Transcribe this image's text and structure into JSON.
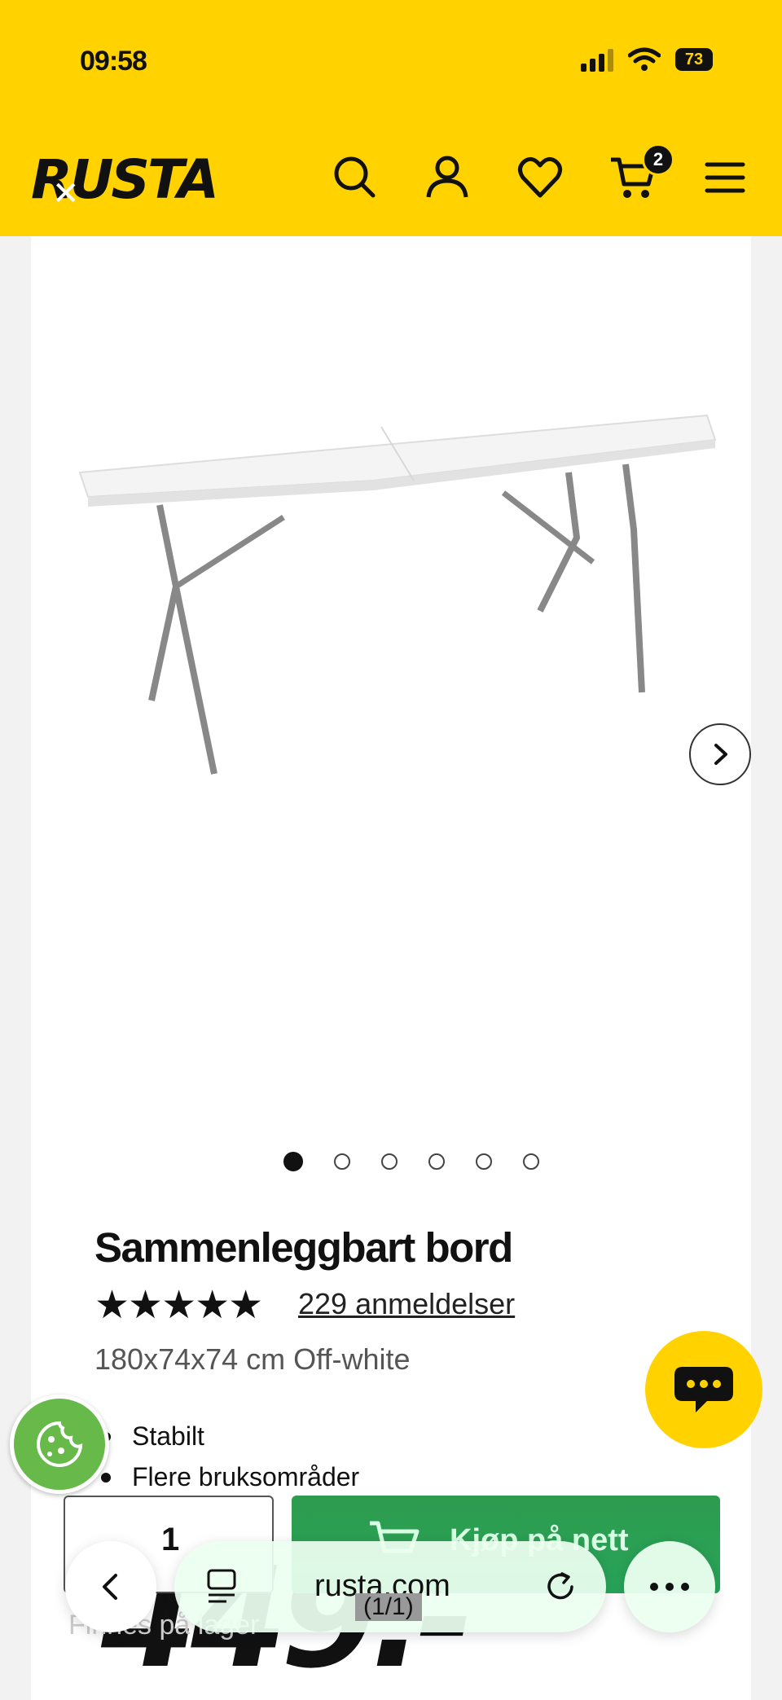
{
  "status_bar": {
    "time": "09:58",
    "battery": "73"
  },
  "header": {
    "logo": "RUSTA",
    "cart_count": "2"
  },
  "product": {
    "title": "Sammenleggbart bord",
    "rating_stars": "★★★★★",
    "reviews": "229 anmeldelser",
    "variant": "180x74x74 cm Off-white",
    "bullets": [
      "Stabilt",
      "Flere bruksområder"
    ],
    "price": "449.-",
    "image_count": 6,
    "active_image": 1
  },
  "purchase": {
    "quantity": "1",
    "buy_label": "Kjøp på nett"
  },
  "footer_hint": "Finnes på lager",
  "browser": {
    "url": "rusta.com",
    "page_count": "(1/1)"
  },
  "colors": {
    "brand_yellow": "#FFD200",
    "buy_green": "#2E9B4E",
    "cookie_green": "#67B94A"
  }
}
